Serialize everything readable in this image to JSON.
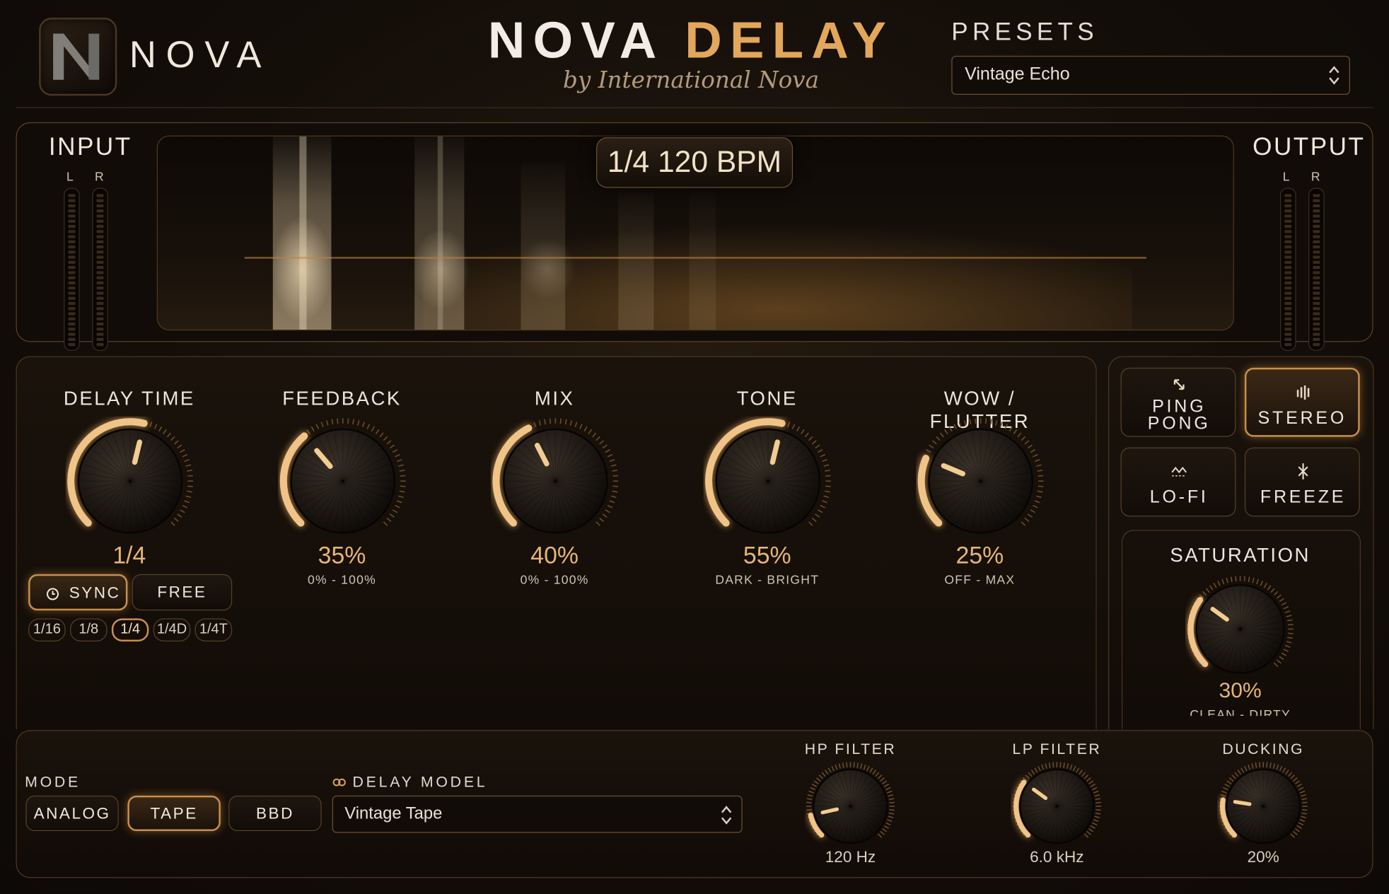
{
  "brand": {
    "name": "NOVA",
    "logo_icon": "n-logo-icon"
  },
  "header": {
    "title_part1": "NOVA",
    "title_part2": "DELAY",
    "byline": "by International Nova"
  },
  "presets": {
    "label": "PRESETS",
    "selected": "Vintage Echo"
  },
  "visualizer": {
    "readout": "1/4 120 BPM"
  },
  "meters": {
    "input": {
      "label": "INPUT",
      "left": "L",
      "right": "R"
    },
    "output": {
      "label": "OUTPUT",
      "left": "L",
      "right": "R"
    }
  },
  "knobs": {
    "delay_time": {
      "label": "DELAY TIME",
      "value": "1/4",
      "level": 0.55
    },
    "feedback": {
      "label": "FEEDBACK",
      "value": "35%",
      "range": "0% - 100%",
      "level": 0.35
    },
    "mix": {
      "label": "MIX",
      "value": "40%",
      "range": "0% - 100%",
      "level": 0.4
    },
    "tone": {
      "label": "TONE",
      "value": "55%",
      "range": "DARK - BRIGHT",
      "level": 0.55
    },
    "wow_flutter": {
      "label": "WOW / FLUTTER",
      "value": "25%",
      "range": "OFF - MAX",
      "level": 0.25
    },
    "saturation": {
      "label": "SATURATION",
      "value": "30%",
      "range": "CLEAN - DIRTY",
      "level": 0.3
    },
    "hp_filter": {
      "label": "HP FILTER",
      "value": "120 Hz",
      "level": 0.12
    },
    "lp_filter": {
      "label": "LP FILTER",
      "value": "6.0 kHz",
      "level": 0.3
    },
    "ducking": {
      "label": "DUCKING",
      "value": "20%",
      "level": 0.2
    }
  },
  "sync": {
    "sync_label": "SYNC",
    "free_label": "FREE",
    "active": "sync"
  },
  "divisions": {
    "items": [
      "1/16",
      "1/8",
      "1/4",
      "1/4D",
      "1/4T"
    ],
    "selected": "1/4"
  },
  "fx": {
    "ping_pong": {
      "label_line1": "PING",
      "label_line2": "PONG",
      "icon": "ping-pong-icon",
      "active": false
    },
    "stereo": {
      "label": "STEREO",
      "icon": "stereo-bars-icon",
      "active": true
    },
    "lofi": {
      "label": "LO-FI",
      "icon": "lofi-wave-icon",
      "active": false
    },
    "freeze": {
      "label": "FREEZE",
      "icon": "freeze-icon",
      "active": false
    }
  },
  "mode": {
    "label": "MODE",
    "options": [
      "ANALOG",
      "TAPE",
      "BBD"
    ],
    "selected": "TAPE"
  },
  "delay_model": {
    "label": "DELAY MODEL",
    "icon": "link-icon",
    "selected": "Vintage Tape"
  },
  "colors": {
    "accent": "#e3a75b",
    "value_text": "#e6b574",
    "background": "#140e09",
    "border": "#5a4128"
  }
}
